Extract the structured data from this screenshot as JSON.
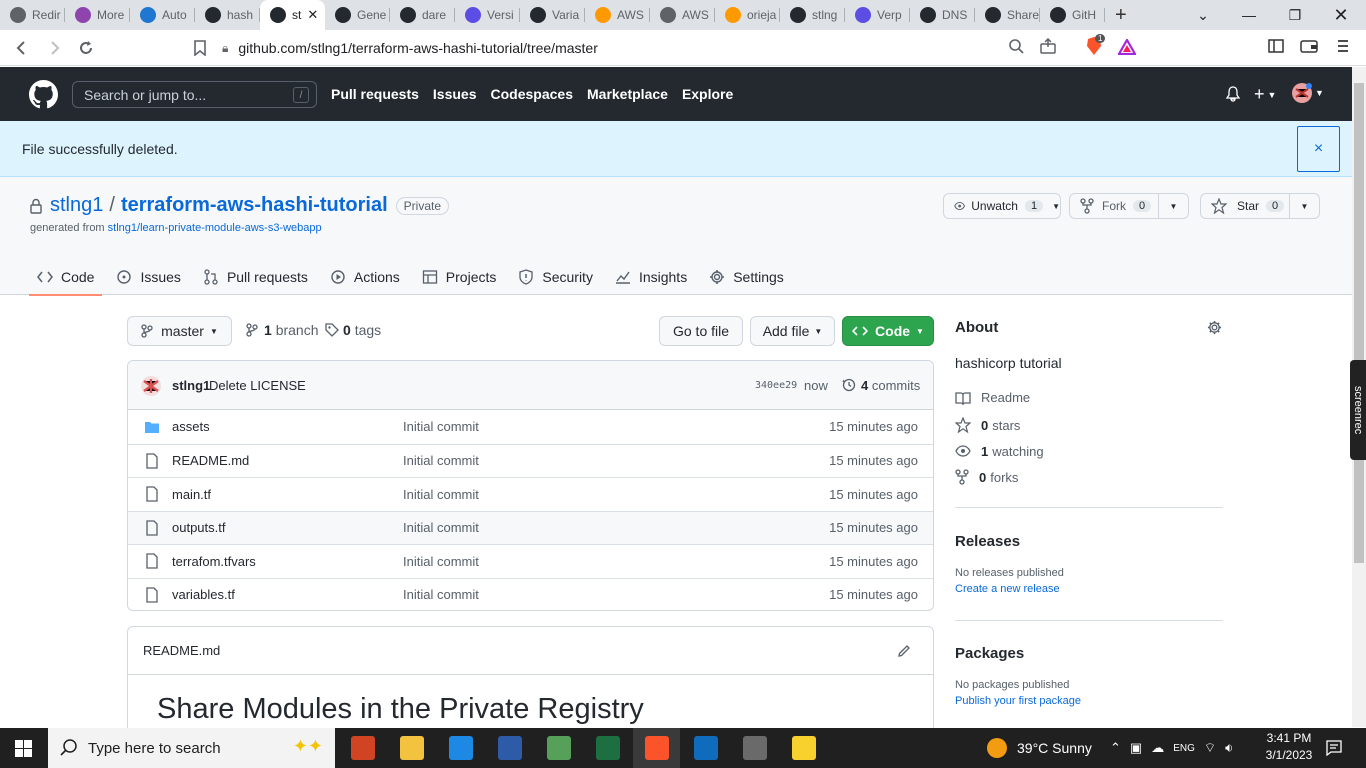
{
  "browser": {
    "tabs": [
      {
        "title": "Redir",
        "color": "#5f6368"
      },
      {
        "title": "More",
        "color": "#8e44ad"
      },
      {
        "title": "Auto",
        "color": "#1f77d0"
      },
      {
        "title": "hash",
        "color": "#24292f"
      },
      {
        "title": "st",
        "color": "#24292f"
      },
      {
        "title": "Gene",
        "color": "#24292f"
      },
      {
        "title": "dare",
        "color": "#24292f"
      },
      {
        "title": "Versi",
        "color": "#5c4ee5"
      },
      {
        "title": "Varia",
        "color": "#24292f"
      },
      {
        "title": "AWS",
        "color": "#ff9900"
      },
      {
        "title": "AWS",
        "color": "#5f6368"
      },
      {
        "title": "orieja",
        "color": "#ff9900"
      },
      {
        "title": "stlng",
        "color": "#24292f"
      },
      {
        "title": "Verp",
        "color": "#5c4ee5"
      },
      {
        "title": "DNS",
        "color": "#24292f"
      },
      {
        "title": "Share",
        "color": "#24292f"
      },
      {
        "title": "GitH",
        "color": "#24292f"
      }
    ],
    "active_tab_index": 4,
    "url": "github.com/stlng1/terraform-aws-hashi-tutorial/tree/master",
    "brave_badge": "1"
  },
  "header": {
    "search_placeholder": "Search or jump to...",
    "search_key": "/",
    "nav": [
      "Pull requests",
      "Issues",
      "Codespaces",
      "Marketplace",
      "Explore"
    ]
  },
  "flash": {
    "message": "File successfully deleted.",
    "close": "×"
  },
  "repo": {
    "owner": "stlng1",
    "separator": "/",
    "name": "terraform-aws-hashi-tutorial",
    "visibility": "Private",
    "generated_prefix": "generated from ",
    "generated_from": "stlng1/learn-private-module-aws-s3-webapp",
    "watch_label": "Unwatch",
    "watch_count": "1",
    "fork_label": "Fork",
    "fork_count": "0",
    "star_label": "Star",
    "star_count": "0",
    "tabs": [
      "Code",
      "Issues",
      "Pull requests",
      "Actions",
      "Projects",
      "Security",
      "Insights",
      "Settings"
    ]
  },
  "toolbar": {
    "branch": "master",
    "branches_count": "1",
    "branches_label": "branch",
    "tags_count": "0",
    "tags_label": "tags",
    "go_to_file": "Go to file",
    "add_file": "Add file",
    "code": "Code"
  },
  "commit": {
    "author": "stlng1",
    "message": "Delete LICENSE",
    "sha": "340ee29",
    "time": "now",
    "commits_count": "4",
    "commits_label": "commits"
  },
  "files": [
    {
      "name": "assets",
      "type": "dir",
      "message": "Initial commit",
      "age": "15 minutes ago"
    },
    {
      "name": "README.md",
      "type": "file",
      "message": "Initial commit",
      "age": "15 minutes ago"
    },
    {
      "name": "main.tf",
      "type": "file",
      "message": "Initial commit",
      "age": "15 minutes ago"
    },
    {
      "name": "outputs.tf",
      "type": "file",
      "message": "Initial commit",
      "age": "15 minutes ago"
    },
    {
      "name": "terrafom.tfvars",
      "type": "file",
      "message": "Initial commit",
      "age": "15 minutes ago"
    },
    {
      "name": "variables.tf",
      "type": "file",
      "message": "Initial commit",
      "age": "15 minutes ago"
    }
  ],
  "readme": {
    "filename": "README.md",
    "heading": "Share Modules in the Private Registry"
  },
  "about": {
    "title": "About",
    "description": "hashicorp tutorial",
    "readme_label": "Readme",
    "stars_count": "0",
    "stars_label": "stars",
    "watching_count": "1",
    "watching_label": "watching",
    "forks_count": "0",
    "forks_label": "forks"
  },
  "releases": {
    "title": "Releases",
    "empty": "No releases published",
    "link": "Create a new release"
  },
  "packages": {
    "title": "Packages",
    "empty": "No packages published",
    "link": "Publish your first package"
  },
  "screenrec": "screenrec",
  "taskbar": {
    "search_placeholder": "Type here to search",
    "weather": "39°C  Sunny",
    "time": "3:41 PM",
    "date": "3/1/2023",
    "lang": "ENG"
  }
}
